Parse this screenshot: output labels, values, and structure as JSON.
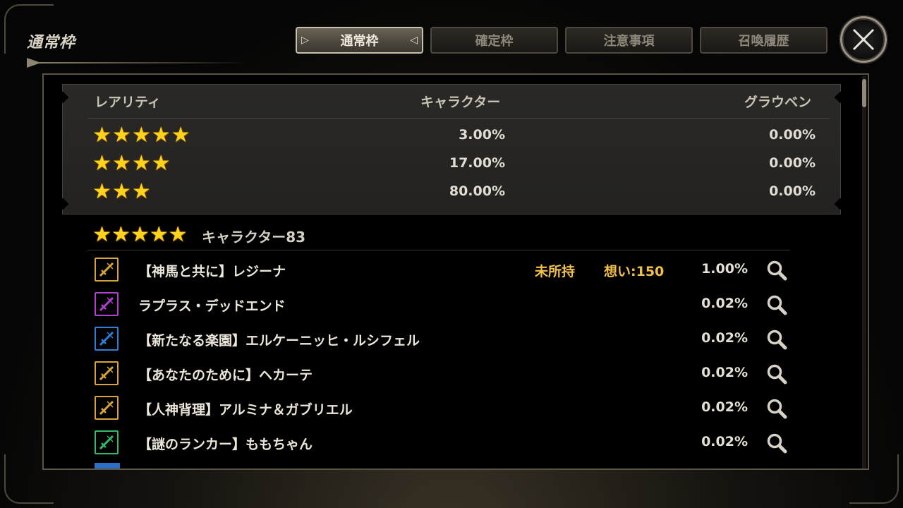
{
  "page_title": "通常枠",
  "tabs": [
    {
      "label": "通常枠",
      "active": true
    },
    {
      "label": "確定枠",
      "active": false
    },
    {
      "label": "注意事項",
      "active": false
    },
    {
      "label": "召喚履歴",
      "active": false
    }
  ],
  "close_icon": "close-x-icon",
  "rates": {
    "headers": {
      "rarity": "レアリティ",
      "character": "キャラクター",
      "grauben": "グラウベン"
    },
    "rows": [
      {
        "stars": 5,
        "character": "3.00%",
        "grauben": "0.00%"
      },
      {
        "stars": 4,
        "character": "17.00%",
        "grauben": "0.00%"
      },
      {
        "stars": 3,
        "character": "80.00%",
        "grauben": "0.00%"
      }
    ]
  },
  "section": {
    "stars": 5,
    "label": "キャラクター83"
  },
  "characters": [
    {
      "name": "【神馬と共に】レジーナ",
      "status": "未所持",
      "omoi": "想い:150",
      "rate": "1.00%",
      "color": "#d8a43a",
      "icon": "sword-class-icon"
    },
    {
      "name": "ラプラス・デッドエンド",
      "status": "",
      "omoi": "",
      "rate": "0.02%",
      "color": "#b23fd0",
      "icon": "bow-class-icon"
    },
    {
      "name": "【新たなる楽園】エルケーニッヒ・ルシフェル",
      "status": "",
      "omoi": "",
      "rate": "0.02%",
      "color": "#2f7fd8",
      "icon": "lance-class-icon"
    },
    {
      "name": "【あなたのために】ヘカーテ",
      "status": "",
      "omoi": "",
      "rate": "0.02%",
      "color": "#d8a43a",
      "icon": "sword-class-icon"
    },
    {
      "name": "【人神背理】アルミナ＆ガブリエル",
      "status": "",
      "omoi": "",
      "rate": "0.02%",
      "color": "#d8a43a",
      "icon": "staff-class-icon"
    },
    {
      "name": "【謎のランカー】ももちゃん",
      "status": "",
      "omoi": "",
      "rate": "0.02%",
      "color": "#34b86a",
      "icon": "axe-class-icon"
    }
  ]
}
